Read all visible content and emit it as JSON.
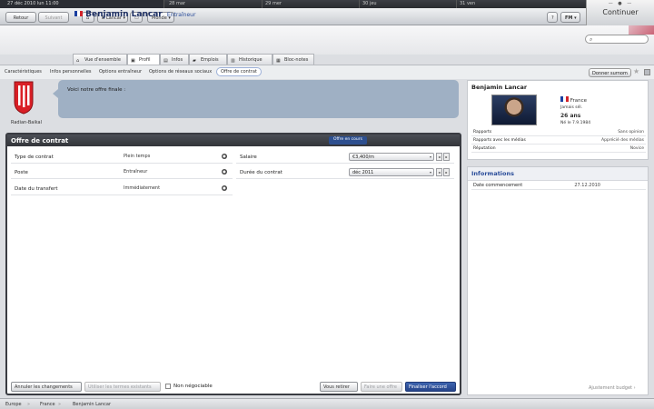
{
  "calendar": {
    "current_date": "27 déc 2010  lun 11:00",
    "days": [
      "28 mar",
      "29 mer",
      "30 jeu",
      "31 ven"
    ]
  },
  "continue_label": "Continuer",
  "toolbar": {
    "back_label": "Retour",
    "next_label": "Suivant",
    "person_label": "B Lancar",
    "world_label": "Monde",
    "help_label": "?",
    "fm_label": "FM"
  },
  "person": {
    "name": "Benjamin Lancar",
    "role": "Entraîneur"
  },
  "tabs": [
    "Vue d'ensemble",
    "Profil",
    "Infos",
    "Emplois",
    "Historique",
    "Bloc-notes"
  ],
  "subnav": [
    "Caractéristiques",
    "Infos personnelles",
    "Options entraîneur",
    "Options de réseaux sociaux",
    "Offre de contrat"
  ],
  "donner_label": "Donner surnom",
  "club": {
    "name": "Radian-Baikal"
  },
  "speech": "Voici notre offre finale :",
  "panel": {
    "title": "Offre de contrat",
    "status_badge": "Offre en cours",
    "left_rows": [
      {
        "label": "Type de contrat",
        "value": "Plein temps"
      },
      {
        "label": "Poste",
        "value": "Entraîneur"
      },
      {
        "label": "Date du transfert",
        "value": "Immédiatement"
      }
    ],
    "right_rows": [
      {
        "label": "Salaire",
        "value": "€3,400/m"
      },
      {
        "label": "Durée du contrat",
        "value": "déc 2011"
      }
    ]
  },
  "buttons": {
    "cancel": "Annuler les changements",
    "use_existing": "Utiliser les termes existants",
    "non_negotiable": "Non négociable",
    "withdraw": "Vous retirer",
    "make_offer": "Faire une offre",
    "finalize": "Finaliser l'accord"
  },
  "profile_card": {
    "name": "Benjamin Lancar",
    "nationality": "France",
    "caps": "Jamais sél.",
    "age": "26 ans",
    "born": "Né le 7.9.1984",
    "rows": [
      {
        "k": "Rapports",
        "v": "Sans opinion"
      },
      {
        "k": "Rapports avec les médias",
        "v": "Apprécié des médias"
      },
      {
        "k": "Réputation",
        "v": "Novice"
      }
    ]
  },
  "info_card": {
    "title": "Informations",
    "rows": [
      {
        "k": "Date commencement",
        "v": "27.12.2010"
      }
    ]
  },
  "budget_label": "Ajustement budget",
  "breadcrumb": [
    "Europe",
    "France",
    "Benjamin Lancar"
  ]
}
